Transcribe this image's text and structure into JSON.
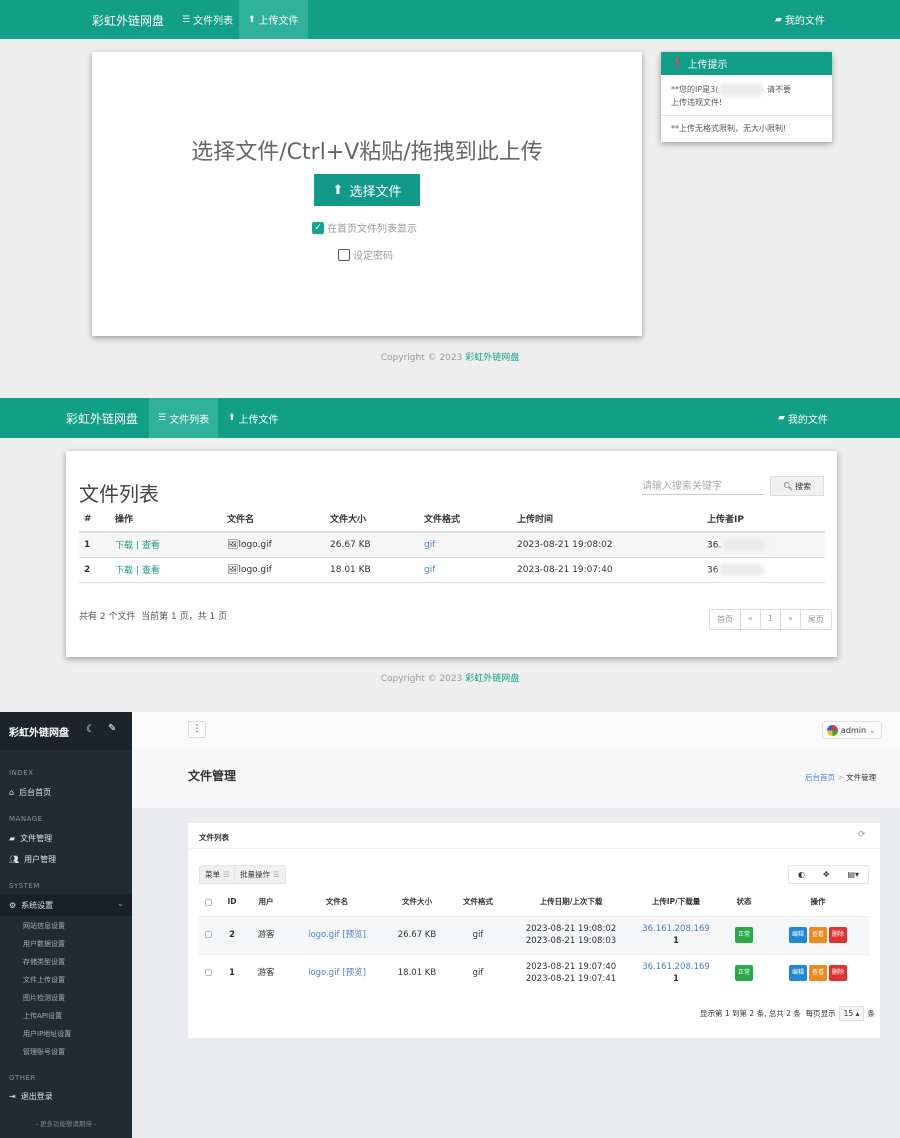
{
  "site": {
    "brand": "彩虹外链网盘",
    "nav": {
      "file_list": "文件列表",
      "upload": "上传文件",
      "my_files": "我的文件"
    },
    "copyright_prefix": "Copyright © 2023 ",
    "copyright_link": "彩虹外链网盘"
  },
  "upload_page": {
    "heading": "选择文件/Ctrl+V粘贴/拖拽到此上传",
    "choose_button": "选择文件",
    "show_in_list_label": "在首页文件列表显示",
    "show_in_list_checked": true,
    "set_password_label": "设定密码",
    "set_password_checked": false,
    "tips": {
      "title": "上传提示",
      "line1_prefix": "**您的IP是3(",
      "line1_suffix": "请不要",
      "line1_cont": "上传违规文件!",
      "line2": "**上传无格式限制，无大小限制!"
    }
  },
  "list_page": {
    "title": "文件列表",
    "search_placeholder": "请输入搜索关键字",
    "search_button": "搜索",
    "columns": [
      "#",
      "操作",
      "文件名",
      "文件大小",
      "文件格式",
      "上传时间",
      "上传者IP"
    ],
    "rows": [
      {
        "num": "1",
        "download": "下载",
        "sep": "|",
        "view": "查看",
        "name": "logo.gif",
        "size": "26.67 KB",
        "format": "gif",
        "time": "2023-08-21 19:08:02",
        "ip": "36."
      },
      {
        "num": "2",
        "download": "下载",
        "sep": "|",
        "view": "查看",
        "name": "logo.gif",
        "size": "18.01 KB",
        "format": "gif",
        "time": "2023-08-21 19:07:40",
        "ip": "36"
      }
    ],
    "summary": "共有 2 个文件  当前第 1 页，共 1 页",
    "pager": [
      "首页",
      "«",
      "1",
      "»",
      "尾页"
    ]
  },
  "admin": {
    "brand": "彩虹外链网盘",
    "user": "admin",
    "page_title": "文件管理",
    "breadcrumb": {
      "home": "后台首页",
      "sep": ">",
      "current": "文件管理"
    },
    "sidebar": {
      "sections": [
        {
          "label": "INDEX",
          "items": [
            "后台首页"
          ]
        },
        {
          "label": "MANAGE",
          "items": [
            "文件管理",
            "用户管理"
          ]
        },
        {
          "label": "SYSTEM",
          "items": [
            "系统设置"
          ]
        },
        {
          "label": "OTHER",
          "items": [
            "退出登录"
          ]
        }
      ],
      "system_subitems": [
        "网站信息设置",
        "用户数据设置",
        "存储类型设置",
        "文件上传设置",
        "图片检测设置",
        "上传API设置",
        "用户IP地址设置",
        "管理账号设置"
      ],
      "footer": "- 更多功能敬请期待 -"
    },
    "panel_title": "文件列表",
    "toolbar": {
      "menu": "菜单",
      "batch": "批量操作"
    },
    "columns": [
      "ID",
      "用户",
      "文件名",
      "文件大小",
      "文件格式",
      "上传日期/上次下载",
      "上传IP/下载量",
      "状态",
      "操作"
    ],
    "rows": [
      {
        "id": "2",
        "user": "游客",
        "name": "logo.gif",
        "preview": "[预览]",
        "size": "26.67 KB",
        "format": "gif",
        "date1": "2023-08-21 19:08:02",
        "date2": "2023-08-21 19:08:03",
        "ip": "36.161.208.169",
        "downloads": "1",
        "status": "正常",
        "actions": [
          "编辑",
          "查看",
          "删除"
        ]
      },
      {
        "id": "1",
        "user": "游客",
        "name": "logo.gif",
        "preview": "[预览]",
        "size": "18.01 KB",
        "format": "gif",
        "date1": "2023-08-21 19:07:40",
        "date2": "2023-08-21 19:07:41",
        "ip": "36.161.208.169",
        "downloads": "1",
        "status": "正常",
        "actions": [
          "编辑",
          "查看",
          "删除"
        ]
      }
    ],
    "pagination_text": "显示第 1 到第 2 条, 总共 2 条  每页显示",
    "page_size": "15",
    "page_size_suffix": "条"
  },
  "colors": {
    "teal": "#129f87",
    "sidebar": "#222a34",
    "link_blue": "#4a7fd0"
  }
}
